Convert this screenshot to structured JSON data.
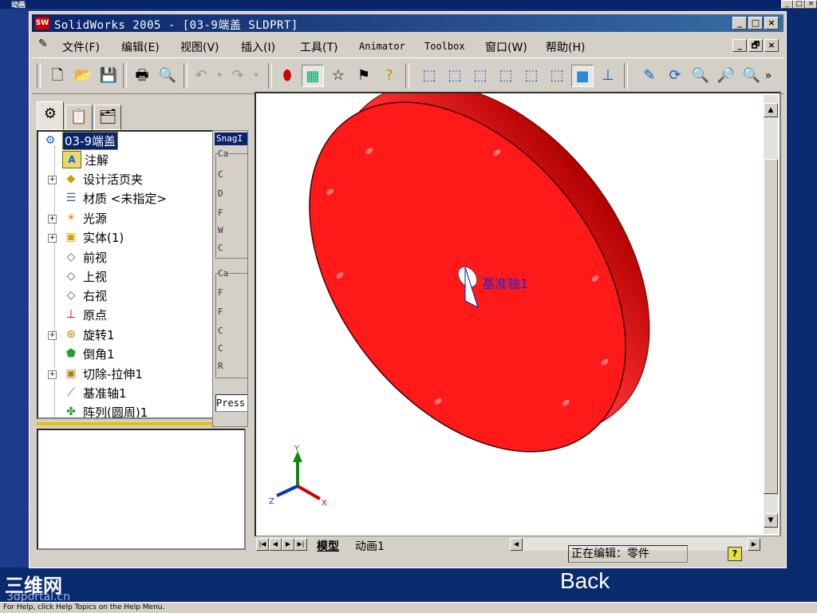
{
  "outer": {
    "title": "动画",
    "controls": [
      "_",
      "□",
      "×"
    ]
  },
  "window": {
    "app_logo": "SW",
    "title": "SolidWorks 2005 - [03-9端盖 SLDPRT]",
    "controls": [
      "_",
      "□",
      "×"
    ],
    "mdi_controls": [
      "_",
      "🗗",
      "×"
    ]
  },
  "menu": [
    {
      "label": "文件(F)"
    },
    {
      "label": "编辑(E)"
    },
    {
      "label": "视图(V)"
    },
    {
      "label": "插入(I)"
    },
    {
      "label": "工具(T)"
    },
    {
      "label": "Animator"
    },
    {
      "label": "Toolbox"
    },
    {
      "label": "窗口(W)"
    },
    {
      "label": "帮助(H)"
    }
  ],
  "toolbar_more": "»",
  "tree": {
    "root": "03-9端盖",
    "items": [
      {
        "label": "注解",
        "icon": "annotation-icon"
      },
      {
        "label": "设计活页夹",
        "icon": "binder-icon"
      },
      {
        "label": "材质 <未指定>",
        "icon": "material-icon"
      },
      {
        "label": "光源",
        "icon": "lighting-icon"
      },
      {
        "label": "实体(1)",
        "icon": "solid-body-icon"
      },
      {
        "label": "前视",
        "icon": "plane-icon"
      },
      {
        "label": "上视",
        "icon": "plane-icon"
      },
      {
        "label": "右视",
        "icon": "plane-icon"
      },
      {
        "label": "原点",
        "icon": "origin-icon"
      },
      {
        "label": "旋转1",
        "icon": "revolve-icon"
      },
      {
        "label": "倒角1",
        "icon": "chamfer-icon"
      },
      {
        "label": "切除-拉伸1",
        "icon": "cut-extrude-icon"
      },
      {
        "label": "基准轴1",
        "icon": "axis-icon"
      },
      {
        "label": "阵列(圆周)1",
        "icon": "pattern-icon"
      }
    ]
  },
  "snagit": {
    "title": "SnagI",
    "group1": "Ca",
    "labels1": [
      "C",
      "D",
      "F",
      "W",
      "C"
    ],
    "group2": "Ca",
    "labels2": [
      "F",
      "F",
      "C",
      "C",
      "R"
    ],
    "press": "Press"
  },
  "viewport": {
    "axis_label": "基准轴1",
    "triad": {
      "x": "X",
      "y": "Y",
      "z": "Z"
    },
    "part_color": "#ff1a1a"
  },
  "sheets": {
    "model": "模型",
    "animation": "动画1"
  },
  "status": {
    "editing": "正在编辑：零件",
    "help": "?"
  },
  "branding": {
    "logo": "三维网",
    "url": "3dportal.cn",
    "back": "Back"
  },
  "footer": "For Help, click Help Topics on the Help Menu."
}
